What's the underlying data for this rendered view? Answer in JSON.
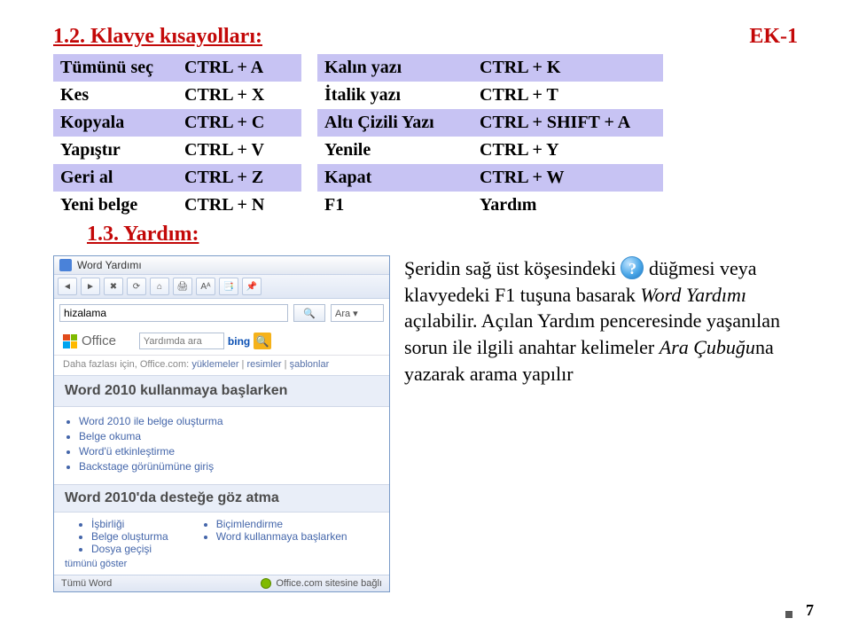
{
  "header": {
    "title": "1.2. Klavye kısayolları:",
    "ek": "EK-1"
  },
  "table1": {
    "rows": [
      {
        "action": "Tümünü seç",
        "key": "CTRL + A"
      },
      {
        "action": "Kes",
        "key": "CTRL + X"
      },
      {
        "action": "Kopyala",
        "key": "CTRL + C"
      },
      {
        "action": "Yapıştır",
        "key": "CTRL + V"
      },
      {
        "action": "Geri al",
        "key": "CTRL + Z"
      },
      {
        "action": "Yeni belge",
        "key": "CTRL + N"
      }
    ]
  },
  "table2": {
    "rows": [
      {
        "action": "Kalın yazı",
        "key": "CTRL + K"
      },
      {
        "action": "İtalik yazı",
        "key": "CTRL + T"
      },
      {
        "action": "Altı Çizili Yazı",
        "key": "CTRL + SHIFT + A"
      },
      {
        "action": "Yenile",
        "key": "CTRL + Y"
      },
      {
        "action": "Kapat",
        "key": "CTRL + W"
      },
      {
        "action": "F1",
        "key": "Yardım"
      }
    ]
  },
  "subtitle": "1.3. Yardım:",
  "help_window": {
    "title": "Word Yardımı",
    "search_value": "hizalama",
    "search_go": "🔍",
    "search_dd": "Ara ▾",
    "office_brand": "Office",
    "bing_placeholder": "Yardımda ara",
    "bing_brand": "bing",
    "more_links_prefix": "Daha fazlası için, Office.com:",
    "more_links": [
      "yüklemeler",
      "resimler",
      "şablonlar"
    ],
    "sec1_title": "Word 2010 kullanmaya başlarken",
    "sec1_items": [
      "Word 2010 ile belge oluşturma",
      "Belge okuma",
      "Word'ü etkinleştirme",
      "Backstage görünümüne giriş"
    ],
    "sec2_title": "Word 2010'da desteğe göz atma",
    "sec2_col1": [
      "İşbirliği",
      "Belge oluşturma",
      "Dosya geçişi"
    ],
    "sec2_col2": [
      "Biçimlendirme",
      "Word kullanmaya başlarken"
    ],
    "sec2_more": "tümünü göster",
    "status_left": "Tümü Word",
    "status_right": "Office.com sitesine bağlı"
  },
  "paragraph": {
    "p1a": "Şeridin sağ üst köşesindeki ",
    "p1b": " düğmesi veya klavyedeki F1 tuşuna basarak ",
    "p1c": "Word Yardımı",
    "p1d": " açılabilir. Açılan Yardım penceresinde yaşanılan sorun ile ilgili anahtar kelimeler ",
    "p1e": "Ara Çubuğu",
    "p1f": "na yazarak arama yapılır"
  },
  "page_num": "7"
}
